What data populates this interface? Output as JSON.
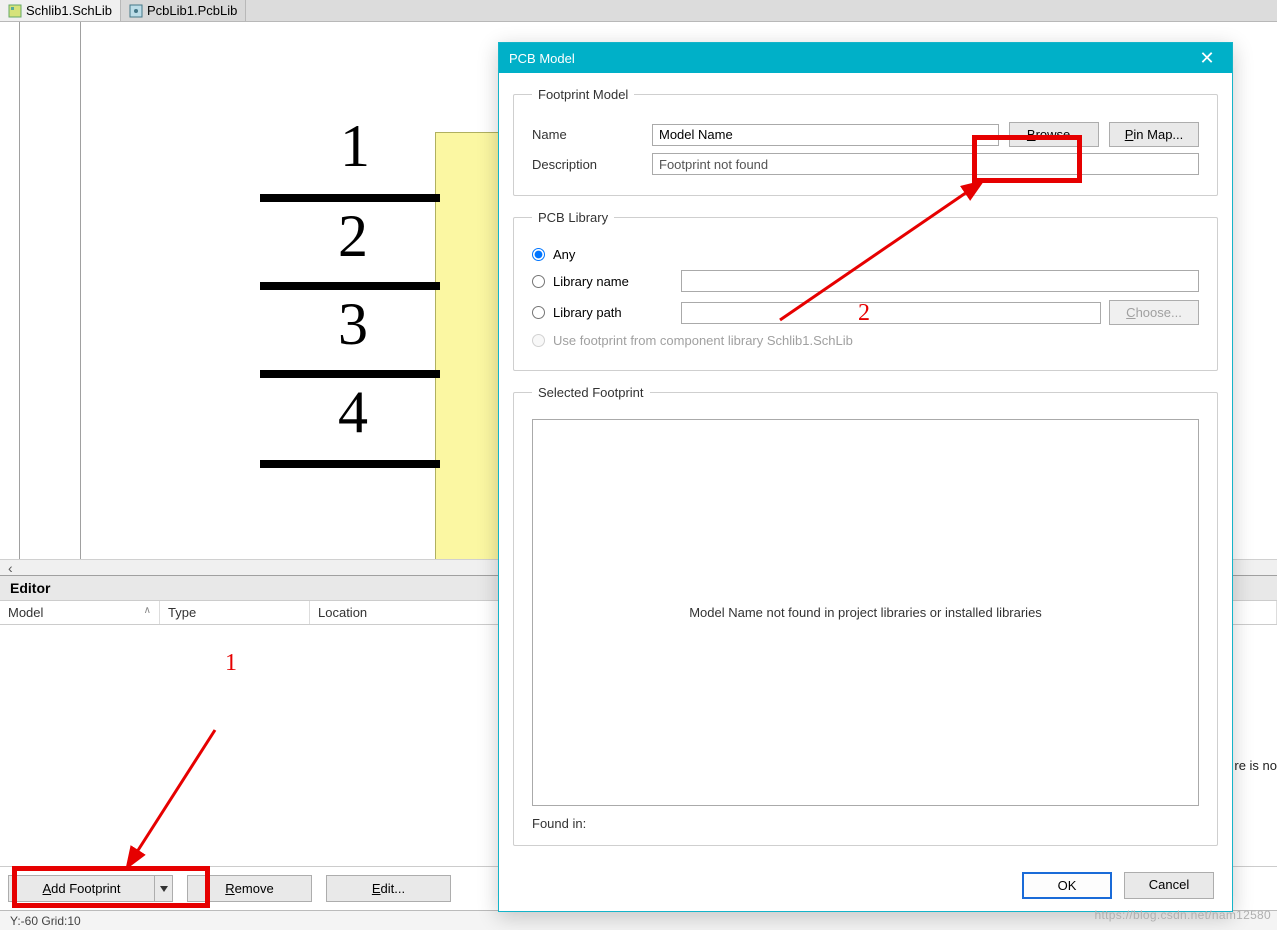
{
  "tabs": [
    {
      "label": "Schlib1.SchLib",
      "icon": "schlib-icon"
    },
    {
      "label": "PcbLib1.PcbLib",
      "icon": "pcblib-icon"
    }
  ],
  "symbol": {
    "pins": [
      "1",
      "2",
      "3",
      "4"
    ]
  },
  "editor": {
    "title": "Editor",
    "columns": {
      "model": "Model",
      "type": "Type",
      "location": "Location"
    },
    "buttons": {
      "add": "Add Footprint",
      "remove": "Remove",
      "edit": "Edit..."
    }
  },
  "status": "Y:-60   Grid:10",
  "right_clip": "re is no",
  "annotations": {
    "one": "1",
    "two": "2"
  },
  "dialog": {
    "title": "PCB Model",
    "footprint_model": {
      "legend": "Footprint Model",
      "name_label": "Name",
      "name_value": "Model Name",
      "browse": "Browse...",
      "pinmap": "Pin Map...",
      "desc_label": "Description",
      "desc_value": "Footprint not found"
    },
    "pcb_library": {
      "legend": "PCB Library",
      "any": "Any",
      "libname": "Library name",
      "libpath": "Library path",
      "choose": "Choose...",
      "use_from": "Use footprint from component library Schlib1.SchLib"
    },
    "selected": {
      "legend": "Selected Footprint",
      "message": "Model Name not found in project libraries or installed libraries",
      "found_label": "Found in:"
    },
    "footer": {
      "ok": "OK",
      "cancel": "Cancel"
    }
  },
  "watermark": "https://blog.csdn.net/nam12580"
}
